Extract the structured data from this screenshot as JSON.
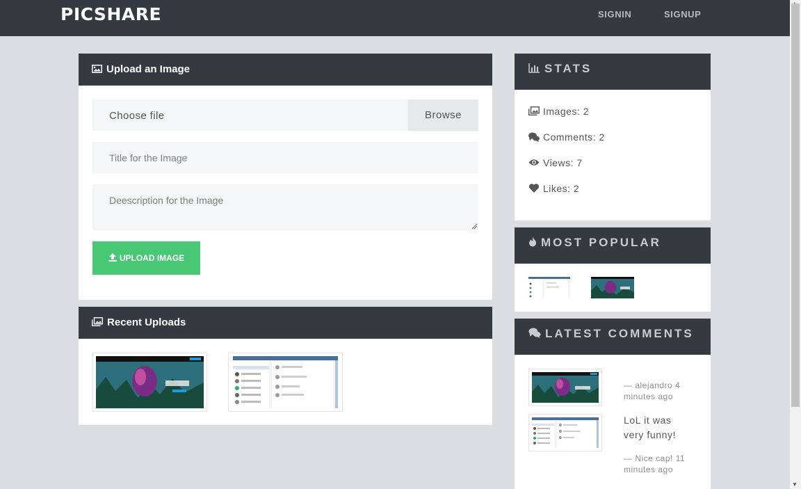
{
  "navbar": {
    "brand": "PICSHARE",
    "signin": "SIGNIN",
    "signup": "SIGNUP"
  },
  "upload": {
    "title": "Upload an Image",
    "file_label": "Choose file",
    "browse_label": "Browse",
    "title_placeholder": "Title for the Image",
    "description_placeholder": "Deescription for the Image",
    "button_label": "UPLOAD IMAGE"
  },
  "recent": {
    "title": "Recent Uploads"
  },
  "stats": {
    "title": "STATS",
    "images": "Images: 2",
    "comments": "Comments: 2",
    "views": "Views: 7",
    "likes": "Likes: 2"
  },
  "popular": {
    "title": "MOST POPULAR"
  },
  "latest": {
    "title": "LATEST COMMENTS",
    "comments": [
      {
        "text": "",
        "meta": "— alejandro 4 minutes ago"
      },
      {
        "text": "LoL it was very funny!",
        "meta": "— Nice cap! 11 minutes ago"
      }
    ]
  },
  "colors": {
    "header_bg": "#343a40",
    "page_bg": "#dcdde0",
    "upload_button": "#48c774"
  }
}
